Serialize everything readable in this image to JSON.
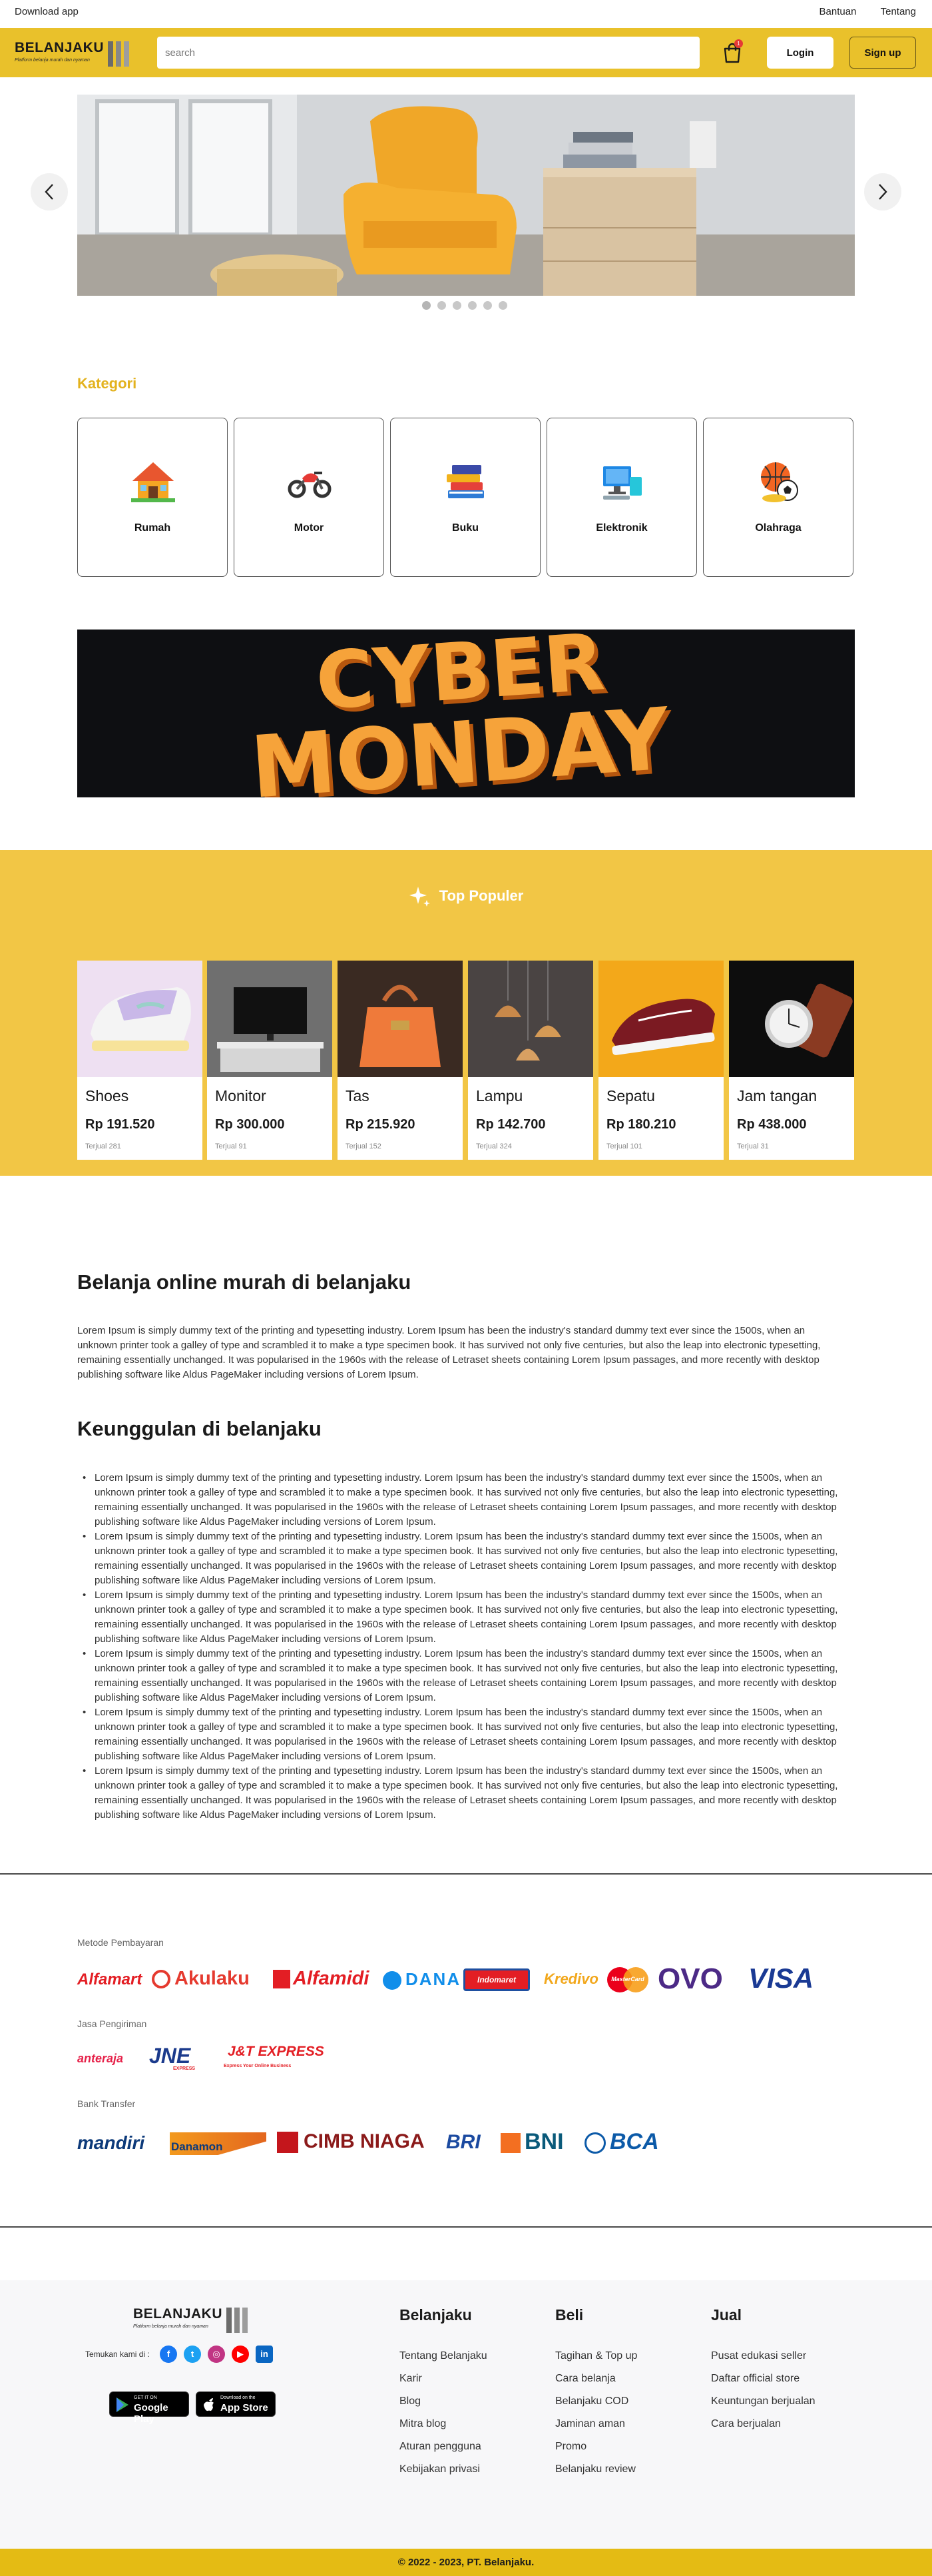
{
  "topbar": {
    "download": "Download app",
    "help": "Bantuan",
    "about": "Tentang"
  },
  "brand": {
    "name": "BELANJAKU",
    "tagline": "Platform belanja murah dan nyaman"
  },
  "header": {
    "search_placeholder": "search",
    "cart_count": "1",
    "login": "Login",
    "signup": "Sign up"
  },
  "colors": {
    "accent": "#e9c12b",
    "accent_light": "#f2c645",
    "title_gold": "#e3b21e"
  },
  "hero": {
    "slide_count": 6,
    "active_slide": 0
  },
  "categories": {
    "title": "Kategori",
    "items": [
      {
        "label": "Rumah",
        "icon": "house-icon"
      },
      {
        "label": "Motor",
        "icon": "motorcycle-icon"
      },
      {
        "label": "Buku",
        "icon": "books-icon"
      },
      {
        "label": "Elektronik",
        "icon": "computer-icon"
      },
      {
        "label": "Olahraga",
        "icon": "sports-balls-icon"
      }
    ]
  },
  "banner": {
    "line1": "CYBER",
    "line2": "MONDAY"
  },
  "popular": {
    "title": "Top Populer",
    "products": [
      {
        "name": "Shoes",
        "price": "Rp 191.520",
        "sold": "Terjual 281"
      },
      {
        "name": "Monitor",
        "price": "Rp 300.000",
        "sold": "Terjual 91"
      },
      {
        "name": "Tas",
        "price": "Rp 215.920",
        "sold": "Terjual 152"
      },
      {
        "name": "Lampu",
        "price": "Rp 142.700",
        "sold": "Terjual 324"
      },
      {
        "name": "Sepatu",
        "price": "Rp 180.210",
        "sold": "Terjual 101"
      },
      {
        "name": "Jam tangan",
        "price": "Rp 438.000",
        "sold": "Terjual 31"
      }
    ]
  },
  "about": {
    "title": "Belanja online murah di belanjaku",
    "text": "Lorem Ipsum is simply dummy text of the printing and typesetting industry. Lorem Ipsum has been the industry's standard dummy text ever since the 1500s, when an unknown printer took a galley of type and scrambled it to make a type specimen book. It has survived not only five centuries, but also the leap into electronic typesetting, remaining essentially unchanged. It was popularised in the 1960s with the release of Letraset sheets containing Lorem Ipsum passages, and more recently with desktop publishing software like Aldus PageMaker including versions of Lorem Ipsum."
  },
  "advantages": {
    "title": "Keunggulan di belanjaku",
    "items": [
      "Lorem Ipsum is simply dummy text of the printing and typesetting industry. Lorem Ipsum has been the industry's standard dummy text ever since the 1500s, when an unknown printer took a galley of type and scrambled it to make a type specimen book. It has survived not only five centuries, but also the leap into electronic typesetting, remaining essentially unchanged. It was popularised in the 1960s with the release of Letraset sheets containing Lorem Ipsum passages, and more recently with desktop publishing software like Aldus PageMaker including versions of Lorem Ipsum.",
      "Lorem Ipsum is simply dummy text of the printing and typesetting industry. Lorem Ipsum has been the industry's standard dummy text ever since the 1500s, when an unknown printer took a galley of type and scrambled it to make a type specimen book. It has survived not only five centuries, but also the leap into electronic typesetting, remaining essentially unchanged. It was popularised in the 1960s with the release of Letraset sheets containing Lorem Ipsum passages, and more recently with desktop publishing software like Aldus PageMaker including versions of Lorem Ipsum.",
      "Lorem Ipsum is simply dummy text of the printing and typesetting industry. Lorem Ipsum has been the industry's standard dummy text ever since the 1500s, when an unknown printer took a galley of type and scrambled it to make a type specimen book. It has survived not only five centuries, but also the leap into electronic typesetting, remaining essentially unchanged. It was popularised in the 1960s with the release of Letraset sheets containing Lorem Ipsum passages, and more recently with desktop publishing software like Aldus PageMaker including versions of Lorem Ipsum.",
      "Lorem Ipsum is simply dummy text of the printing and typesetting industry. Lorem Ipsum has been the industry's standard dummy text ever since the 1500s, when an unknown printer took a galley of type and scrambled it to make a type specimen book. It has survived not only five centuries, but also the leap into electronic typesetting, remaining essentially unchanged. It was popularised in the 1960s with the release of Letraset sheets containing Lorem Ipsum passages, and more recently with desktop publishing software like Aldus PageMaker including versions of Lorem Ipsum.",
      "Lorem Ipsum is simply dummy text of the printing and typesetting industry. Lorem Ipsum has been the industry's standard dummy text ever since the 1500s, when an unknown printer took a galley of type and scrambled it to make a type specimen book. It has survived not only five centuries, but also the leap into electronic typesetting, remaining essentially unchanged. It was popularised in the 1960s with the release of Letraset sheets containing Lorem Ipsum passages, and more recently with desktop publishing software like Aldus PageMaker including versions of Lorem Ipsum.",
      "Lorem Ipsum is simply dummy text of the printing and typesetting industry. Lorem Ipsum has been the industry's standard dummy text ever since the 1500s, when an unknown printer took a galley of type and scrambled it to make a type specimen book. It has survived not only five centuries, but also the leap into electronic typesetting, remaining essentially unchanged. It was popularised in the 1960s with the release of Letraset sheets containing Lorem Ipsum passages, and more recently with desktop publishing software like Aldus PageMaker including versions of Lorem Ipsum."
    ]
  },
  "payments": {
    "methods_label": "Metode Pembayaran",
    "methods": [
      "Alfamart",
      "Akulaku",
      "Alfamidi",
      "DANA",
      "Indomaret",
      "Kredivo",
      "MasterCard",
      "OVO",
      "VISA"
    ],
    "shipping_label": "Jasa Pengiriman",
    "shipping": [
      "anteraja",
      "JNE",
      "J&T EXPRESS"
    ],
    "shipping_sub": [
      "EXPRESS",
      "Express Your Online Business"
    ],
    "bank_label": "Bank Transfer",
    "banks": [
      "mandiri",
      "Danamon",
      "CIMB NIAGA",
      "BRI",
      "BNI",
      "BCA"
    ]
  },
  "footer": {
    "find_us": "Temukan kami di :",
    "google_play": {
      "small": "GET IT ON",
      "big": "Google Play"
    },
    "app_store": {
      "small": "Download on the",
      "big": "App Store"
    },
    "cols": [
      {
        "title": "Belanjaku",
        "items": [
          "Tentang Belanjaku",
          "Karir",
          "Blog",
          "Mitra blog",
          "Aturan pengguna",
          "Kebijakan privasi"
        ]
      },
      {
        "title": "Beli",
        "items": [
          "Tagihan & Top up",
          "Cara belanja",
          "Belanjaku COD",
          "Jaminan aman",
          "Promo",
          "Belanjaku review"
        ]
      },
      {
        "title": "Jual",
        "items": [
          "Pusat edukasi seller",
          "Daftar official store",
          "Keuntungan berjualan",
          "Cara berjualan"
        ]
      }
    ],
    "copyright": "© 2022 - 2023, PT. Belanjaku."
  }
}
